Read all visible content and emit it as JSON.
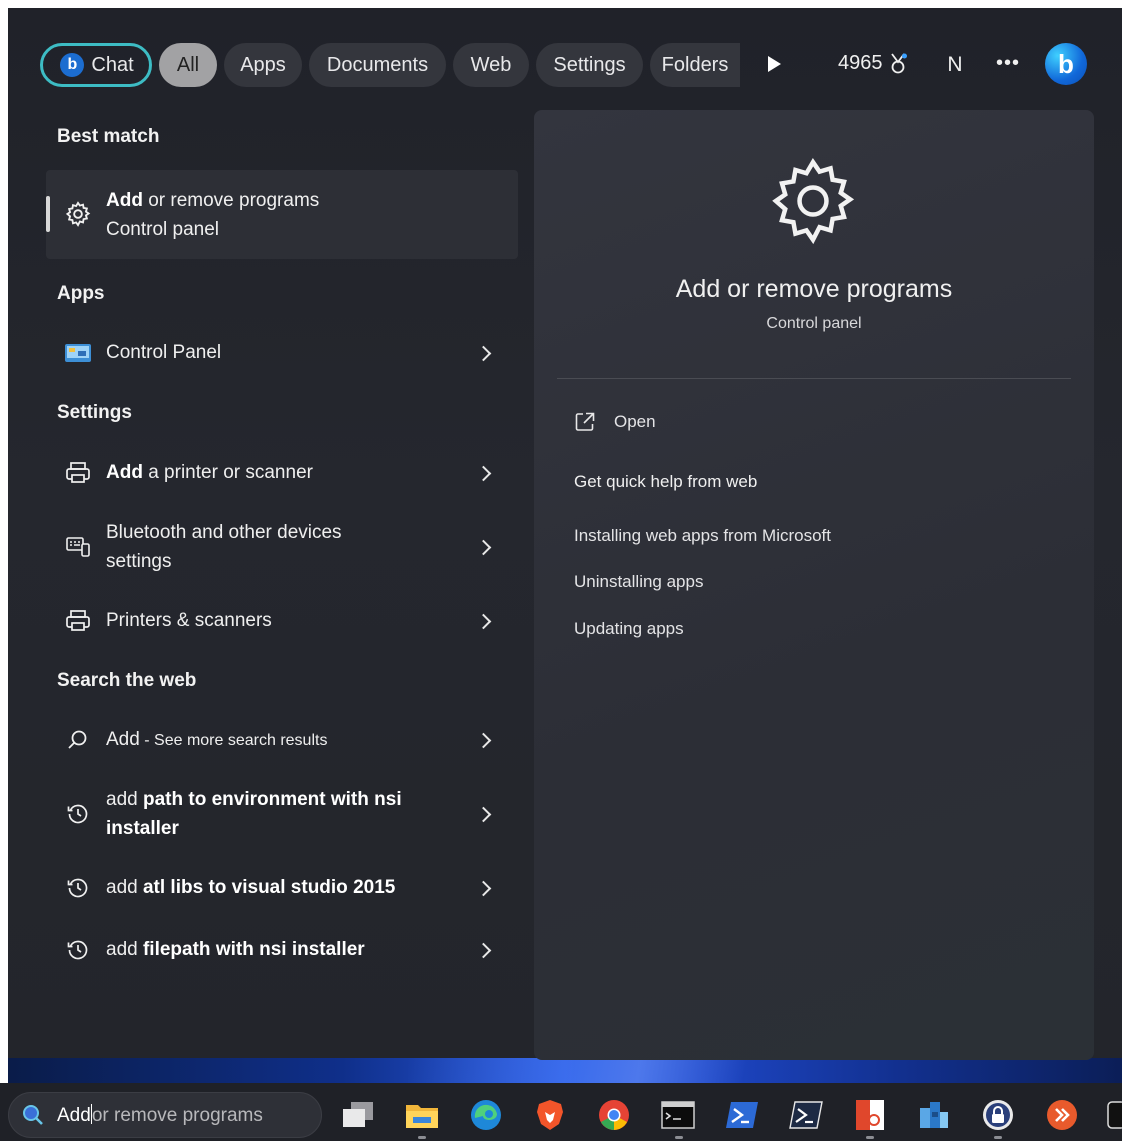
{
  "tabs": {
    "chat": "Chat",
    "all": "All",
    "apps": "Apps",
    "documents": "Documents",
    "web": "Web",
    "settings": "Settings",
    "folders": "Folders"
  },
  "header": {
    "points": "4965",
    "avatar_initial": "N"
  },
  "best_match": {
    "heading": "Best match",
    "title_bold": "Add",
    "title_rest": " or remove programs",
    "subtitle": "Control panel",
    "icon": "gear-icon"
  },
  "apps_section": {
    "heading": "Apps",
    "items": [
      {
        "label": "Control Panel",
        "icon": "control-panel-icon"
      }
    ]
  },
  "settings_section": {
    "heading": "Settings",
    "items": [
      {
        "bold": "Add",
        "rest": " a printer or scanner",
        "icon": "printer-icon"
      },
      {
        "line1": "Bluetooth and other devices",
        "line2": "settings",
        "icon": "devices-icon"
      },
      {
        "label": "Printers & scanners",
        "icon": "printer-icon"
      }
    ]
  },
  "web_section": {
    "heading": "Search the web",
    "items": [
      {
        "bold": "Add",
        "rest": " - See more search results",
        "icon": "search-icon"
      },
      {
        "pre": "add ",
        "bold1": "path to environment with nsi",
        "bold2": "installer",
        "icon": "history-icon"
      },
      {
        "pre": "add ",
        "bold": "atl libs to visual studio 2015",
        "icon": "history-icon"
      },
      {
        "pre": "add ",
        "bold": "filepath with nsi installer",
        "icon": "history-icon"
      }
    ]
  },
  "preview": {
    "title": "Add or remove programs",
    "subtitle": "Control panel",
    "open_label": "Open",
    "help_heading": "Get quick help from web",
    "links": [
      "Installing web apps from Microsoft",
      "Uninstalling apps",
      "Updating apps"
    ]
  },
  "taskbar": {
    "search_typed": "Add",
    "search_rest": "or remove programs",
    "apps": [
      "task-view",
      "file-explorer",
      "edge",
      "brave",
      "chrome",
      "command-prompt",
      "powershell",
      "powershell-admin",
      "office",
      "unknown-app",
      "password-manager",
      "remote-app",
      "terminal"
    ]
  },
  "colors": {
    "chat_border": "#3dbcc4",
    "all_pill": "#a2a2a4",
    "panel": "#202229",
    "preview": "#33353e"
  }
}
